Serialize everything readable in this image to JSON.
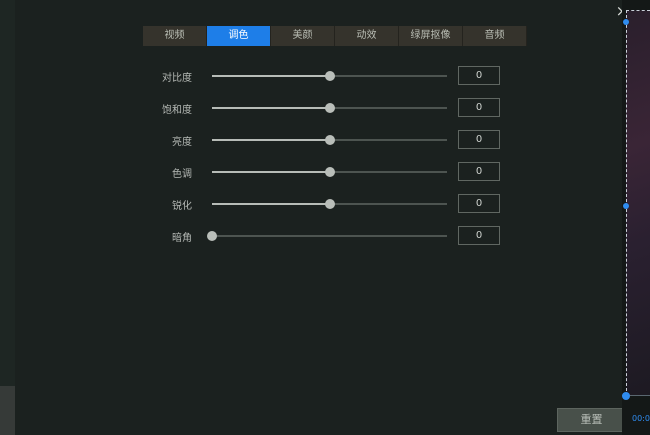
{
  "window": {
    "close_symbol": "×"
  },
  "tabs": [
    {
      "label": "视频",
      "active": false
    },
    {
      "label": "调色",
      "active": true
    },
    {
      "label": "美颜",
      "active": false
    },
    {
      "label": "动效",
      "active": false
    },
    {
      "label": "绿屏抠像",
      "active": false
    },
    {
      "label": "音频",
      "active": false
    }
  ],
  "adjustments": [
    {
      "label": "对比度",
      "value": "0",
      "slider_position": 0.5
    },
    {
      "label": "饱和度",
      "value": "0",
      "slider_position": 0.5
    },
    {
      "label": "亮度",
      "value": "0",
      "slider_position": 0.5
    },
    {
      "label": "色调",
      "value": "0",
      "slider_position": 0.5
    },
    {
      "label": "锐化",
      "value": "0",
      "slider_position": 0.5
    },
    {
      "label": "暗角",
      "value": "0",
      "slider_position": 0.0
    }
  ],
  "reset_label": "重置",
  "preview": {
    "time_label": "00:0"
  },
  "colors": {
    "accent": "#1e7ee8",
    "panel_bg": "#1b211f",
    "tab_bg": "#35332c"
  }
}
